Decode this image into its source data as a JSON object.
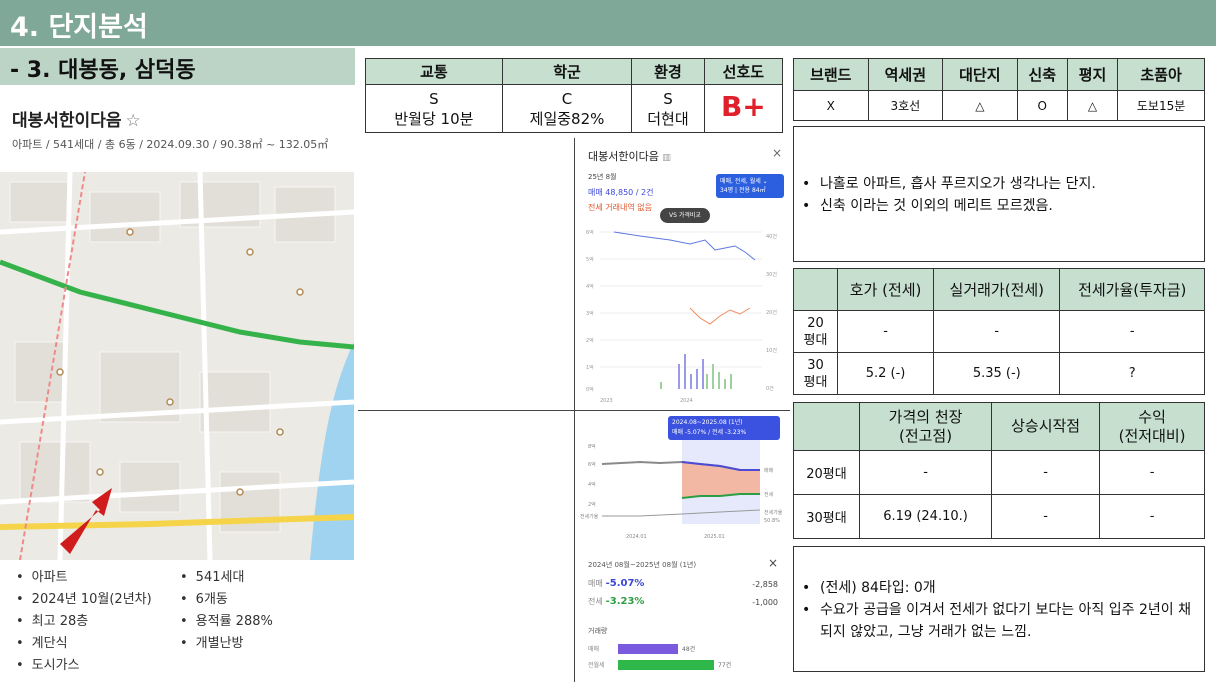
{
  "header": {
    "title": "4. 단지분석",
    "subtitle": "- 3. 대봉동, 삼덕동"
  },
  "complex": {
    "name": "대봉서한이다음",
    "info": "아파트 / 541세대 / 총 6동 / 2024.09.30 / 90.38㎡ ~ 132.05㎡"
  },
  "facts": {
    "col1": [
      "아파트",
      "2024년 10월(2년차)",
      "최고 28층",
      "계단식",
      "도시가스"
    ],
    "col2": [
      "541세대",
      "6개동",
      "용적률 288%",
      "개별난방"
    ]
  },
  "grade_table": {
    "headers": [
      "교통",
      "학군",
      "환경",
      "선호도"
    ],
    "cells": [
      {
        "grade": "S",
        "detail": "반월당 10분"
      },
      {
        "grade": "C",
        "detail": "제일중82%"
      },
      {
        "grade": "S",
        "detail": "더현대"
      },
      {
        "grade": "B+",
        "detail": ""
      }
    ]
  },
  "brand_table": {
    "headers": [
      "브랜드",
      "역세권",
      "대단지",
      "신축",
      "평지",
      "초품아"
    ],
    "values": [
      "X",
      "3호선",
      "△",
      "O",
      "△",
      "도보15분"
    ]
  },
  "note1": {
    "lines": [
      "나홀로 아파트, 흡사 푸르지오가 생각나는 단지.",
      "신축 이라는 것 이외의 메리트 모르겠음."
    ]
  },
  "price_table": {
    "headers": [
      "",
      "호가 (전세)",
      "실거래가(전세)",
      "전세가율(투자금)"
    ],
    "rows": [
      {
        "label": "20\n평대",
        "values": [
          "-",
          "-",
          "-"
        ]
      },
      {
        "label": "30\n평대",
        "values": [
          "5.2 (-)",
          "5.35 (-)",
          "?"
        ]
      }
    ]
  },
  "peak_table": {
    "headers": [
      "",
      "가격의 천장\n(전고점)",
      "상승시작점",
      "수익\n(전저대비)"
    ],
    "rows": [
      {
        "label": "20평대",
        "values": [
          "-",
          "-",
          "-"
        ]
      },
      {
        "label": "30평대",
        "values": [
          "6.19 (24.10.)",
          "-",
          "-"
        ]
      }
    ]
  },
  "note2": {
    "lines": [
      "(전세) 84타입: 0개",
      "수요가 공급을 이겨서 전세가 없다기 보다는 아직 입주 2년이 채 되지 않았고, 그냥 거래가 없는 느낌."
    ]
  },
  "chart_card": {
    "title": "대봉서한이다음",
    "period": "25년 8월",
    "sale": "매매 48,850 / 2건",
    "jeonse": "전세 거래내역 없음",
    "filter_label": "매매, 전세, 월세",
    "area_label": "34평 | 전용 84㎡",
    "compare_label": "VS 가격비교",
    "y_left": [
      "6억",
      "5억",
      "4억",
      "3억",
      "2억",
      "1억",
      "0억"
    ],
    "y_right": [
      "40건",
      "30건",
      "20건",
      "10건",
      "0건"
    ],
    "x_ticks": [
      "2023",
      "2024"
    ]
  },
  "trend_card": {
    "range_title": "2024.08~2025.08 (1년)",
    "range_values": "매매 -5.07% / 전세 -3.23%",
    "y_labels": [
      "8억",
      "6억",
      "4억",
      "2억",
      "전세가율"
    ],
    "x_ticks": [
      "2024.01",
      "2025.01"
    ],
    "right_labels": [
      "매매",
      "전세",
      "전세가율",
      "50.8%"
    ]
  },
  "summary_card": {
    "range": "2024년 08월~2025년 08월 (1년)",
    "sale_label": "매매",
    "sale_pct": "-5.07%",
    "sale_amt": "-2,858",
    "jeonse_label": "전세",
    "jeonse_pct": "-3.23%",
    "jeonse_amt": "-1,000",
    "volume_title": "거래량",
    "vol_sale_label": "매매",
    "vol_sale_count": "48건",
    "vol_sale_frac": 0.4,
    "vol_jeonse_label": "전월세",
    "vol_jeonse_count": "77건",
    "vol_jeonse_frac": 0.64
  },
  "colors": {
    "header": "#7fa898",
    "subheader": "#bcd4c6",
    "table_head": "#c6dfcf",
    "sale": "#4b4bd6",
    "jeonse": "#2e9e44",
    "accent_red": "#e0202a"
  }
}
